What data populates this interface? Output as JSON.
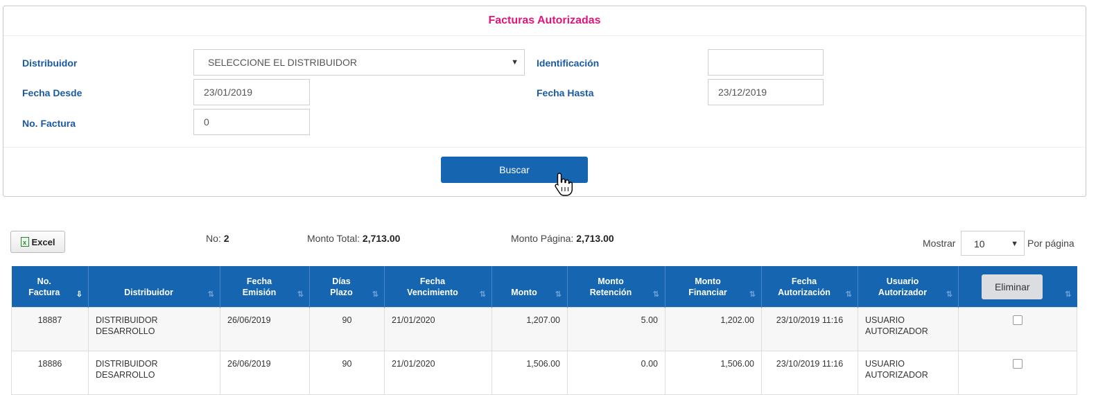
{
  "filter": {
    "title": "Facturas Autorizadas",
    "distribuidor_label": "Distribuidor",
    "distribuidor_value": "SELECCIONE EL DISTRIBUIDOR",
    "identificacion_label": "Identificación",
    "identificacion_value": "",
    "fecha_desde_label": "Fecha Desde",
    "fecha_desde_value": "23/01/2019",
    "fecha_hasta_label": "Fecha Hasta",
    "fecha_hasta_value": "23/12/2019",
    "no_factura_label": "No. Factura",
    "no_factura_value": "0",
    "buscar_label": "Buscar"
  },
  "toolbar": {
    "excel_label": "Excel",
    "no_label": "No:",
    "no_value": "2",
    "monto_total_label": "Monto Total:",
    "monto_total_value": "2,713.00",
    "monto_pagina_label": "Monto Página:",
    "monto_pagina_value": "2,713.00",
    "mostrar_label": "Mostrar",
    "mostrar_value": "10",
    "por_pagina_label": "Por página"
  },
  "table": {
    "headers": {
      "no_factura_1": "No.",
      "no_factura_2": "Factura",
      "distribuidor": "Distribuidor",
      "fecha_emision_1": "Fecha",
      "fecha_emision_2": "Emisión",
      "dias_plazo_1": "Días",
      "dias_plazo_2": "Plazo",
      "fecha_venc_1": "Fecha",
      "fecha_venc_2": "Vencimiento",
      "monto": "Monto",
      "monto_ret_1": "Monto",
      "monto_ret_2": "Retención",
      "monto_fin_1": "Monto",
      "monto_fin_2": "Financiar",
      "fecha_aut_1": "Fecha",
      "fecha_aut_2": "Autorización",
      "usuario_1": "Usuario",
      "usuario_2": "Autorizador",
      "eliminar": "Eliminar"
    },
    "rows": [
      {
        "no_factura": "18887",
        "distribuidor_1": "DISTRIBUIDOR",
        "distribuidor_2": "DESARROLLO",
        "fecha_emision": "26/06/2019",
        "dias_plazo": "90",
        "fecha_vencimiento": "21/01/2020",
        "monto": "1,207.00",
        "monto_retencion": "5.00",
        "monto_financiar": "1,202.00",
        "fecha_autorizacion": "23/10/2019 11:16",
        "usuario_1": "USUARIO",
        "usuario_2": "AUTORIZADOR"
      },
      {
        "no_factura": "18886",
        "distribuidor_1": "DISTRIBUIDOR",
        "distribuidor_2": "DESARROLLO",
        "fecha_emision": "26/06/2019",
        "dias_plazo": "90",
        "fecha_vencimiento": "21/01/2020",
        "monto": "1,506.00",
        "monto_retencion": "0.00",
        "monto_financiar": "1,506.00",
        "fecha_autorizacion": "23/10/2019 11:16",
        "usuario_1": "USUARIO",
        "usuario_2": "AUTORIZADOR"
      }
    ]
  },
  "colors": {
    "title": "#e0157a",
    "label": "#1a5aa4",
    "primary": "#1565b0"
  }
}
